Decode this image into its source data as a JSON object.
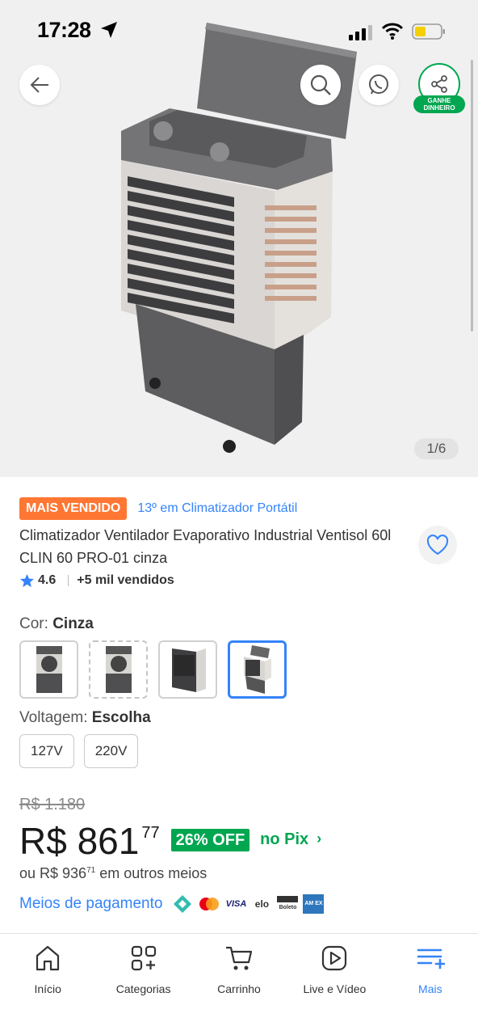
{
  "status_bar": {
    "time": "17:28"
  },
  "gallery": {
    "counter": "1/6",
    "share_badge": "GANHE DINHEIRO"
  },
  "product": {
    "badge": "MAIS VENDIDO",
    "ranking": "13º em Climatizador Portátil",
    "title": "Climatizador Ventilador Evaporativo Industrial Ventisol 60l CLIN 60 PRO-01 cinza",
    "rating": "4.6",
    "sold": "+5 mil vendidos"
  },
  "options": {
    "color_label": "Cor:",
    "color_value": "Cinza",
    "voltage_label": "Voltagem:",
    "voltage_value": "Escolha",
    "voltages": [
      "127V",
      "220V"
    ]
  },
  "price": {
    "old": "R$ 1.180",
    "main": "R$ 861",
    "cents": "77",
    "discount": "26% OFF",
    "pix": "no Pix",
    "other_prefix": "ou R$ 936",
    "other_cents": "71",
    "other_suffix": " em outros meios",
    "payment_link": "Meios de pagamento"
  },
  "payment_icons": [
    "pix-icon",
    "mastercard-icon",
    "visa-icon",
    "elo-icon",
    "boleto-icon",
    "amex-icon"
  ],
  "payment_labels": {
    "visa": "VISA",
    "elo": "elo",
    "boleto": "Boleto",
    "amex": "AM EX"
  },
  "nav": [
    {
      "label": "Início",
      "icon": "home-icon"
    },
    {
      "label": "Categorias",
      "icon": "categories-icon"
    },
    {
      "label": "Carrinho",
      "icon": "cart-icon"
    },
    {
      "label": "Live e Vídeo",
      "icon": "video-icon"
    },
    {
      "label": "Mais",
      "icon": "menu-plus-icon"
    }
  ],
  "colors": {
    "accent": "#3483fa",
    "green": "#00a650",
    "badge_orange": "#ff7733"
  }
}
